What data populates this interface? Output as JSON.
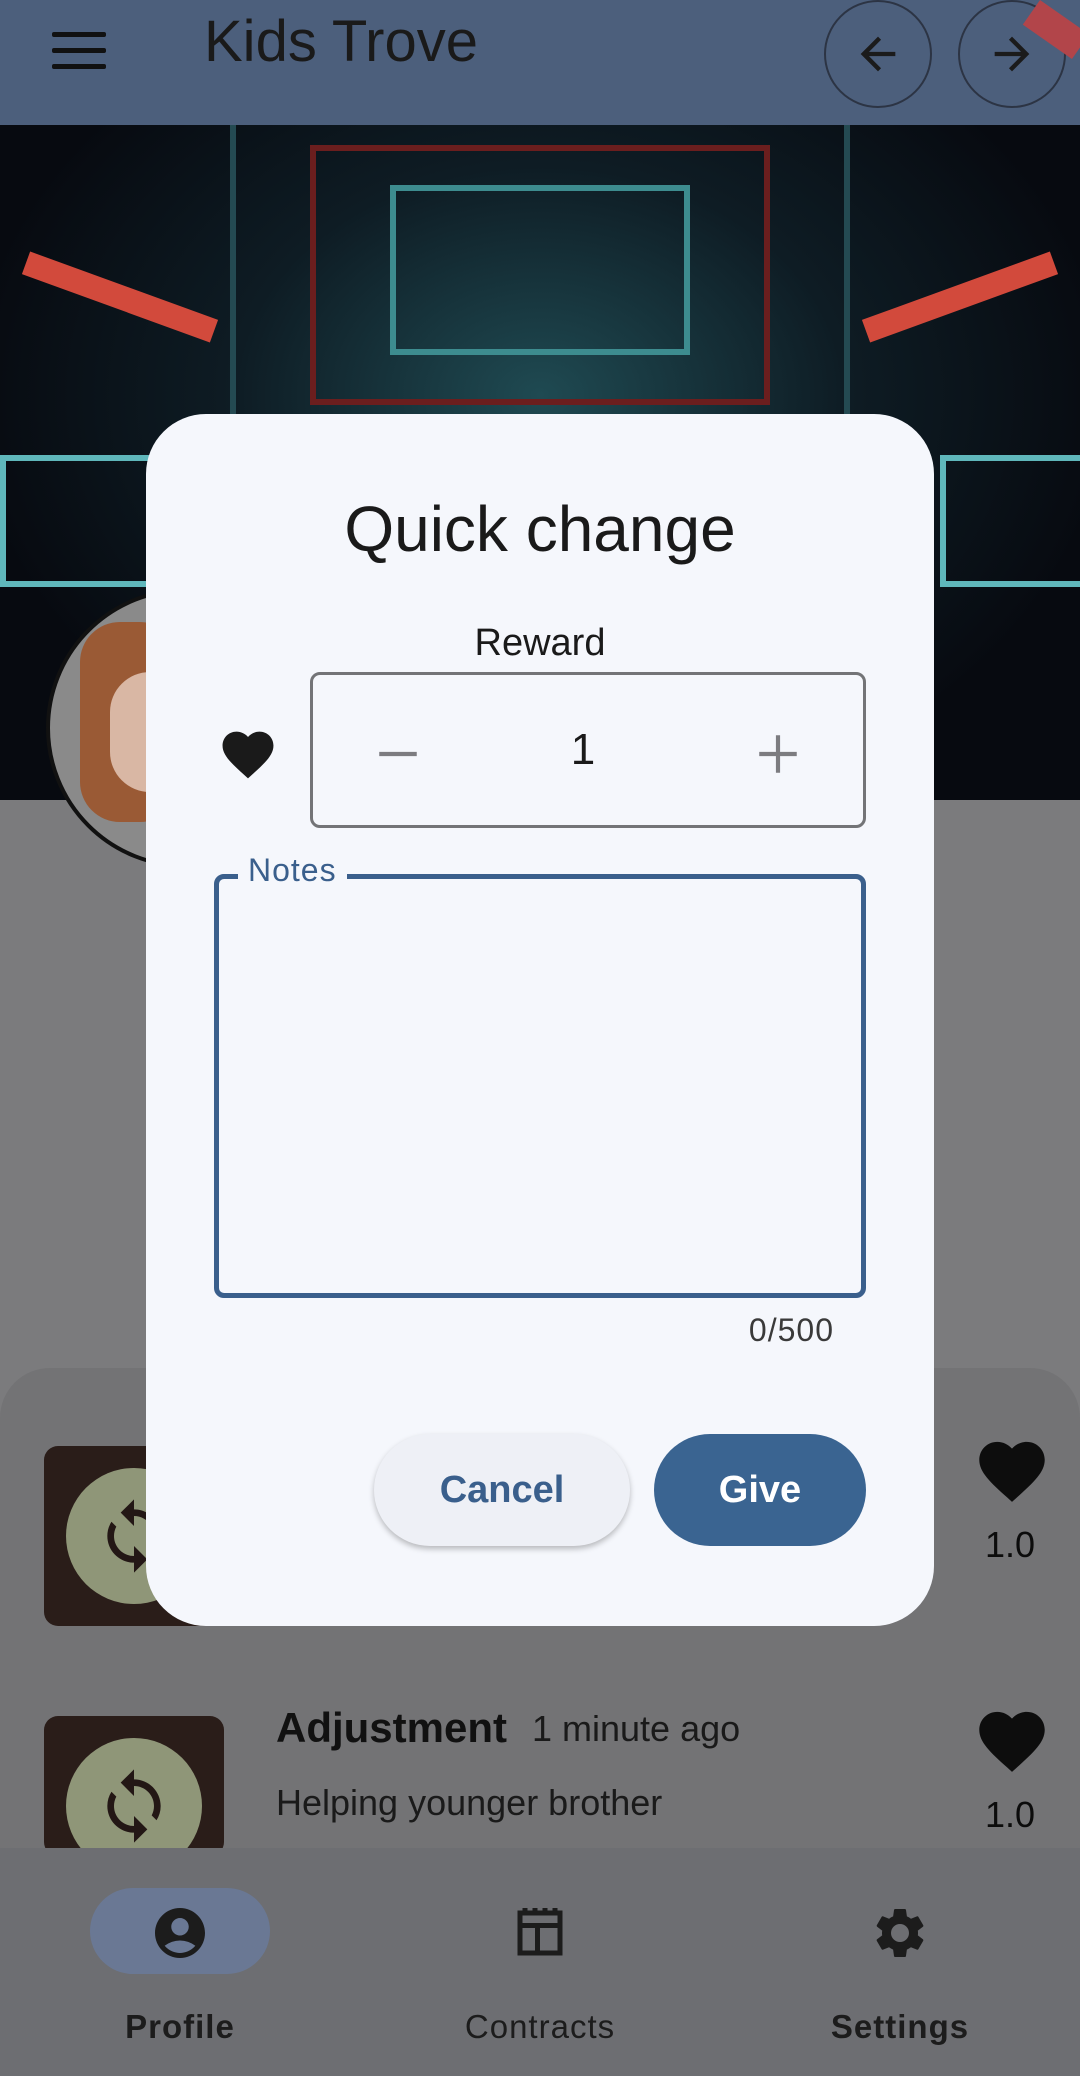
{
  "app": {
    "title": "Kids Trove"
  },
  "dialog": {
    "title": "Quick change",
    "reward_label": "Reward",
    "reward_value": "1",
    "notes_label": "Notes",
    "notes_value": "",
    "counter": "0/500",
    "cancel_label": "Cancel",
    "give_label": "Give"
  },
  "list": {
    "items": [
      {
        "title": "",
        "time": "",
        "note": "",
        "value": "1.0"
      },
      {
        "title": "Adjustment",
        "time": "1 minute ago",
        "note": "Helping younger brother",
        "value": "1.0"
      }
    ]
  },
  "bottom_nav": {
    "items": [
      {
        "label": "Profile",
        "icon": "account-circle-icon"
      },
      {
        "label": "Contracts",
        "icon": "contract-icon"
      },
      {
        "label": "Settings",
        "icon": "gear-icon"
      }
    ]
  },
  "colors": {
    "primary": "#3a6491",
    "appbar": "#4c5f7c",
    "dialog_bg": "#f5f7fc"
  }
}
